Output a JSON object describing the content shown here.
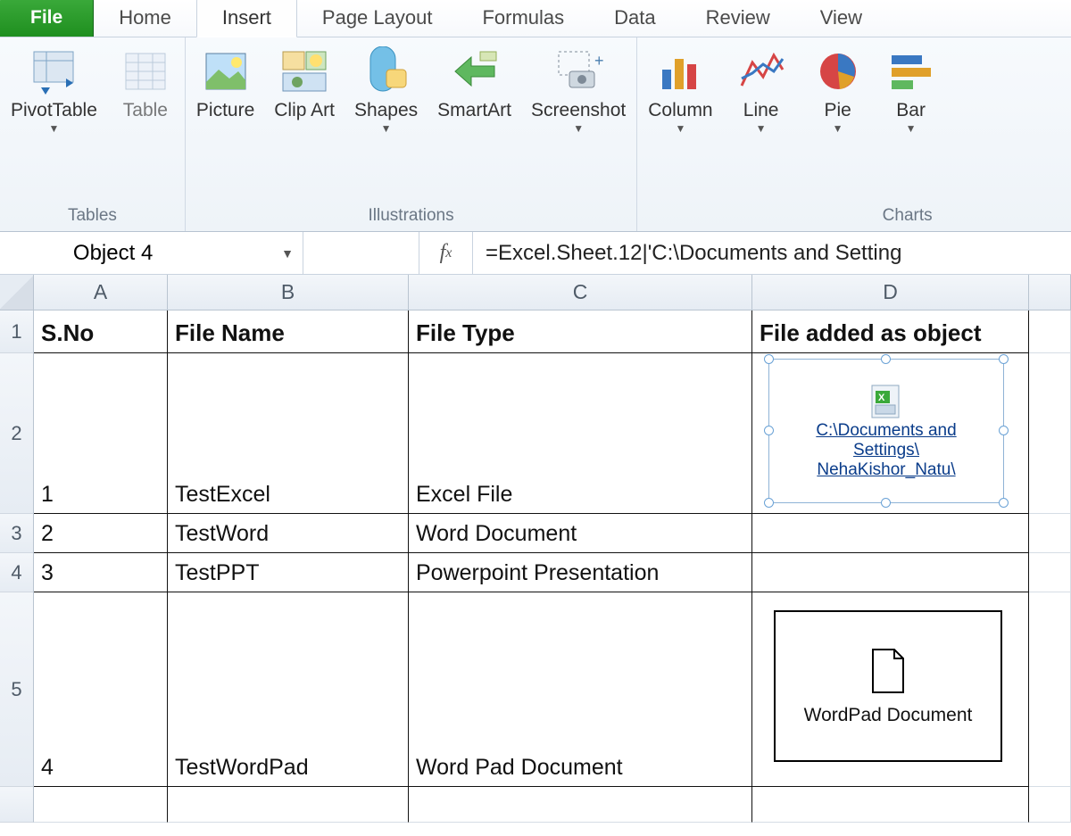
{
  "tabs": {
    "file": "File",
    "home": "Home",
    "insert": "Insert",
    "page_layout": "Page Layout",
    "formulas": "Formulas",
    "data": "Data",
    "review": "Review",
    "view": "View"
  },
  "ribbon": {
    "tables": {
      "caption": "Tables",
      "pivot": "PivotTable",
      "table": "Table"
    },
    "illustrations": {
      "caption": "Illustrations",
      "picture": "Picture",
      "clip_art": "Clip Art",
      "shapes": "Shapes",
      "smartart": "SmartArt",
      "screenshot": "Screenshot"
    },
    "charts": {
      "caption": "Charts",
      "column": "Column",
      "line": "Line",
      "pie": "Pie",
      "bar": "Bar"
    }
  },
  "namebox": "Object 4",
  "formula": "=Excel.Sheet.12|'C:\\Documents and Setting",
  "col_headers": {
    "A": "A",
    "B": "B",
    "C": "C",
    "D": "D"
  },
  "table": {
    "headers": {
      "sno": "S.No",
      "fname": "File Name",
      "ftype": "File Type",
      "fobj": "File added as object"
    },
    "rows": [
      {
        "n": "1",
        "sno": "1",
        "fname": "TestExcel",
        "ftype": "Excel File"
      },
      {
        "n": "2",
        "sno": "2",
        "fname": "TestWord",
        "ftype": "Word Document"
      },
      {
        "n": "3",
        "sno": "3",
        "fname": "TestPPT",
        "ftype": "Powerpoint Presentation"
      },
      {
        "n": "4",
        "sno": "4",
        "fname": "TestWordPad",
        "ftype": "Word Pad Document"
      }
    ]
  },
  "object1": {
    "path_line1": "C:\\Documents and",
    "path_line2": "Settings\\",
    "path_line3": "NehaKishor_Natu\\"
  },
  "object2": {
    "label": "WordPad Document"
  }
}
